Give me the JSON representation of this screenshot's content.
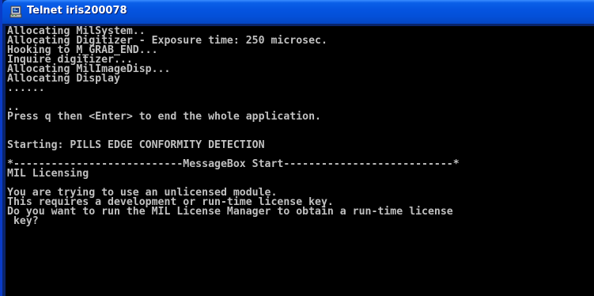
{
  "window": {
    "title": "Telnet iris200078",
    "icon": "telnet-console-icon",
    "colors": {
      "titlebar": "#0554e0",
      "console_background": "#000000",
      "console_text": "#c0c0c0"
    }
  },
  "console": {
    "lines": [
      "Allocating MilSystem..",
      "Allocating Digitizer - Exposure time: 250 microsec.",
      "Hooking to M_GRAB_END...",
      "Inquire digitizer...",
      "Allocating MilImageDisp...",
      "Allocating Display",
      "......",
      "",
      "..",
      "Press q then <Enter> to end the whole application.",
      "",
      "",
      "Starting: PILLS EDGE CONFORMITY DETECTION",
      "",
      "*---------------------------MessageBox Start---------------------------*",
      "MIL Licensing",
      "",
      "You are trying to use an unlicensed module.",
      "This requires a development or run-time license key.",
      "Do you want to run the MIL License Manager to obtain a run-time license",
      " key?"
    ]
  }
}
